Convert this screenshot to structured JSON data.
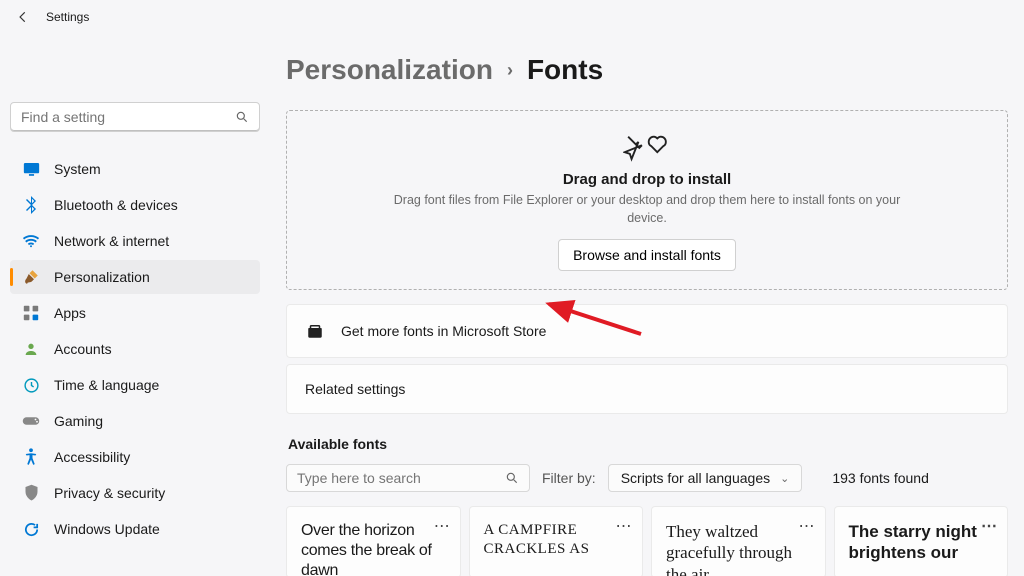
{
  "titlebar": {
    "title": "Settings"
  },
  "sidebar": {
    "search_placeholder": "Find a setting",
    "items": [
      {
        "label": "System"
      },
      {
        "label": "Bluetooth & devices"
      },
      {
        "label": "Network & internet"
      },
      {
        "label": "Personalization"
      },
      {
        "label": "Apps"
      },
      {
        "label": "Accounts"
      },
      {
        "label": "Time & language"
      },
      {
        "label": "Gaming"
      },
      {
        "label": "Accessibility"
      },
      {
        "label": "Privacy & security"
      },
      {
        "label": "Windows Update"
      }
    ]
  },
  "breadcrumb": {
    "parent": "Personalization",
    "current": "Fonts"
  },
  "dropzone": {
    "title": "Drag and drop to install",
    "subtitle": "Drag font files from File Explorer or your desktop and drop them here to install fonts on your device.",
    "button": "Browse and install fonts"
  },
  "store_row": {
    "label": "Get more fonts in Microsoft Store"
  },
  "related": {
    "label": "Related settings"
  },
  "available": {
    "title": "Available fonts",
    "search_placeholder": "Type here to search",
    "filter_label": "Filter by:",
    "filter_value": "Scripts for all languages",
    "count_text": "193 fonts found"
  },
  "font_cards": [
    {
      "sample": "Over the horizon comes the break of dawn"
    },
    {
      "sample": "A campfire crackles as"
    },
    {
      "sample": "They waltzed gracefully through the air"
    },
    {
      "sample": "The starry night brightens our"
    }
  ]
}
